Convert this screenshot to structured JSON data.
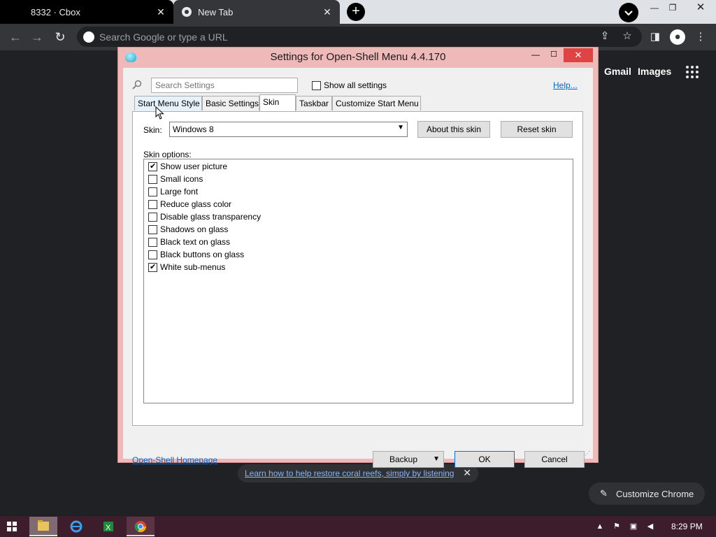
{
  "browser": {
    "tabs": [
      {
        "title": "8332 · Cbox"
      },
      {
        "title": "New Tab"
      }
    ],
    "omnibox_placeholder": "Search Google or type a URL",
    "ntp_links": {
      "gmail": "Gmail",
      "images": "Images"
    },
    "promo_text": "Learn how to help restore coral reefs, simply by listening",
    "customize_label": "Customize Chrome"
  },
  "dialog": {
    "title": "Settings for Open-Shell Menu 4.4.170",
    "search_placeholder": "Search Settings",
    "show_all_label": "Show all settings",
    "help_label": "Help...",
    "tabs": [
      "Start Menu Style",
      "Basic Settings",
      "Skin",
      "Taskbar",
      "Customize Start Menu"
    ],
    "active_tab": "Skin",
    "skin_label": "Skin:",
    "skin_value": "Windows 8",
    "about_skin_label": "About this skin",
    "reset_skin_label": "Reset skin",
    "skin_options_label": "Skin options:",
    "options": [
      {
        "label": "Show user picture",
        "checked": true
      },
      {
        "label": "Small icons",
        "checked": false
      },
      {
        "label": "Large font",
        "checked": false
      },
      {
        "label": "Reduce glass color",
        "checked": false
      },
      {
        "label": "Disable glass transparency",
        "checked": false
      },
      {
        "label": "Shadows on glass",
        "checked": false
      },
      {
        "label": "Black text on glass",
        "checked": false
      },
      {
        "label": "Black buttons on glass",
        "checked": false
      },
      {
        "label": "White sub-menus",
        "checked": true
      }
    ],
    "homepage_label": "Open-Shell Homepage",
    "backup_label": "Backup",
    "ok_label": "OK",
    "cancel_label": "Cancel"
  },
  "taskbar": {
    "clock": "8:29 PM"
  },
  "colors": {
    "dialog_frame": "#f0b9b9",
    "chrome_dark": "#35363a",
    "taskbar": "#3d1c2b",
    "link": "#0066cc"
  }
}
